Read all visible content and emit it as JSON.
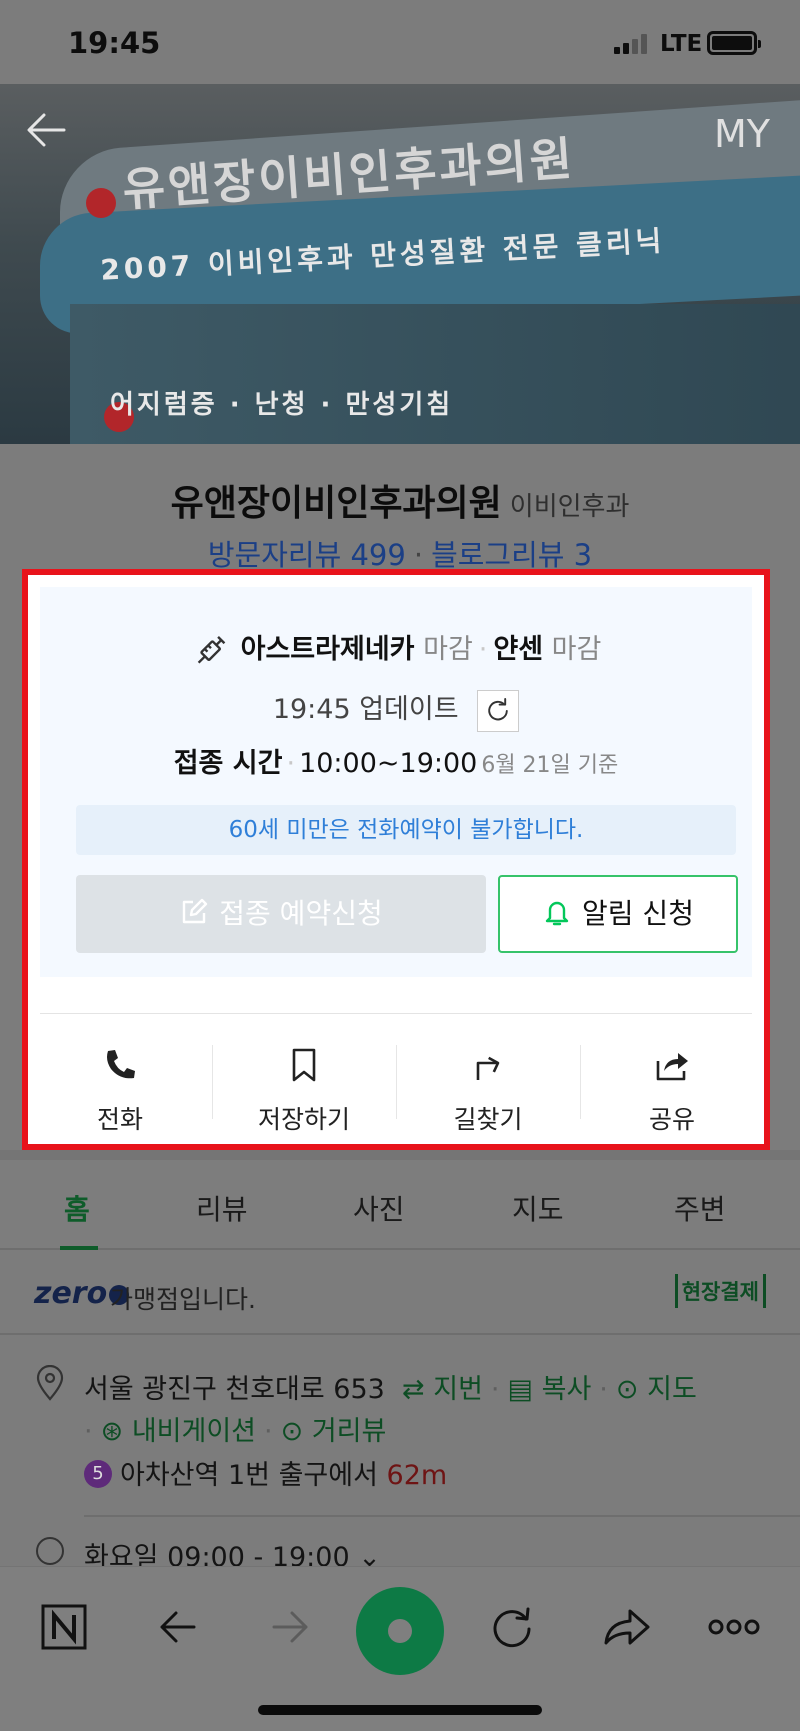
{
  "status_bar": {
    "time": "19:45",
    "network": "LTE"
  },
  "header": {
    "my_label": "MY"
  },
  "hero": {
    "sign_main": "유앤장이비인후과의원",
    "sign_sub": "2007 이비인후과 만성질환 전문 클리닉",
    "sign_bottom": "어지럼증 · 난청 · 만성기침"
  },
  "place": {
    "name": "유앤장이비인후과의원",
    "category": "이비인후과",
    "visitor_reviews": "방문자리뷰 499",
    "blog_reviews": "블로그리뷰 3"
  },
  "vaccine": {
    "vaccine1_name": "아스트라제네카",
    "vaccine1_status": "마감",
    "vaccine2_name": "얀센",
    "vaccine2_status": "마감",
    "update_text": "19:45 업데이트",
    "time_label": "접종 시간",
    "time_value": "10:00~19:00",
    "time_basis": "6월 21일 기준",
    "notice": "60세 미만은 전화예약이 불가합니다.",
    "reserve_label": "접종 예약신청",
    "alert_label": "알림 신청"
  },
  "actions": [
    {
      "label": "전화",
      "icon": "phone-icon"
    },
    {
      "label": "저장하기",
      "icon": "bookmark-icon"
    },
    {
      "label": "길찾기",
      "icon": "directions-icon"
    },
    {
      "label": "공유",
      "icon": "share-icon"
    }
  ],
  "tabs": [
    "홈",
    "리뷰",
    "사진",
    "지도",
    "주변"
  ],
  "zeropay": {
    "logo": "zero",
    "text": "가맹점입니다.",
    "badge": "현장결제"
  },
  "address": {
    "text": "서울 광진구 천호대로 653",
    "lot_number": "지번",
    "copy": "복사",
    "map": "지도",
    "navigation": "내비게이션",
    "street_view": "거리뷰",
    "subway_line": "5",
    "station": "아차산역",
    "exit_text": "1번 출구에서",
    "distance": "62m"
  },
  "hours": {
    "text": "화요일 09:00 - 19:00"
  },
  "colors": {
    "accent_green": "#03c75a",
    "highlight_red": "#e8131b",
    "notice_blue": "#2f7fd8"
  }
}
